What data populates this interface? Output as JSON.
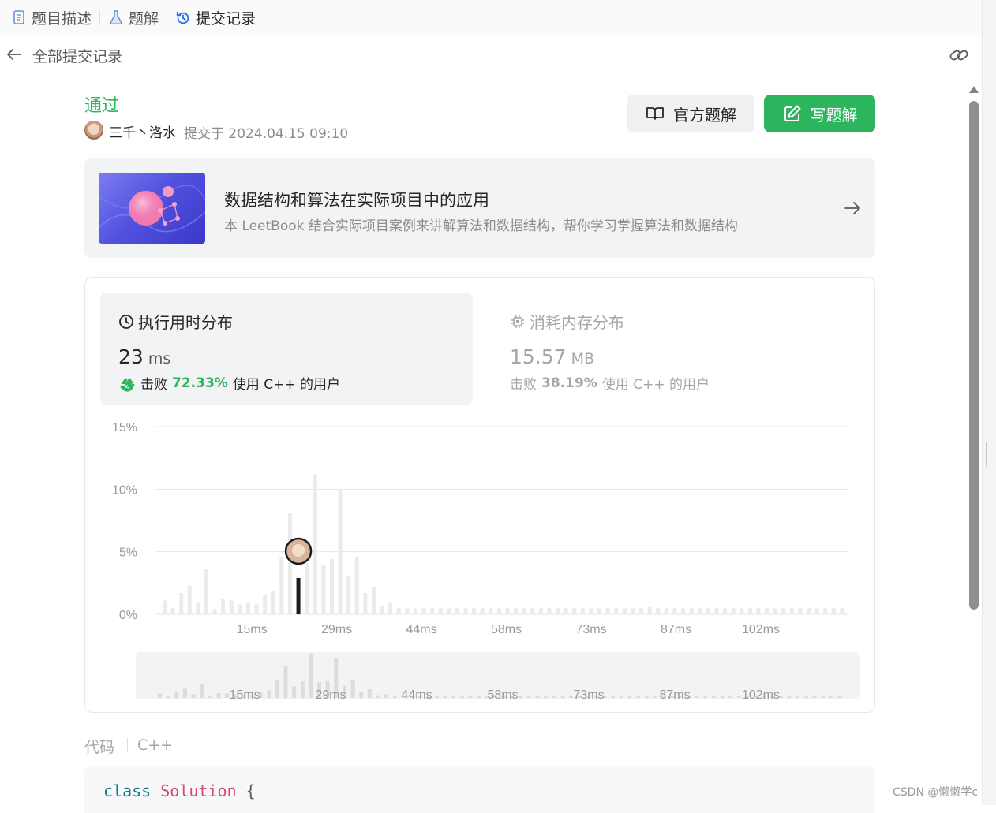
{
  "tabs": [
    {
      "label": "题目描述",
      "icon": "document-icon"
    },
    {
      "label": "题解",
      "icon": "flask-icon"
    },
    {
      "label": "提交记录",
      "icon": "history-icon"
    }
  ],
  "subheader": {
    "title": "全部提交记录"
  },
  "submission": {
    "status": "通过",
    "author": "三千丶洛水",
    "submitted_label": "提交于 2024.04.15 09:10"
  },
  "buttons": {
    "official": "官方题解",
    "write": "写题解"
  },
  "leetbook": {
    "title": "数据结构和算法在实际项目中的应用",
    "desc": "本 LeetBook 结合实际项目案例来讲解算法和数据结构，帮你学习掌握算法和数据结构"
  },
  "runtime": {
    "title": "执行用时分布",
    "value": "23",
    "unit": "ms",
    "beats_prefix": "击败",
    "beats_pct": "72.33%",
    "beats_suffix": "使用 C++ 的用户"
  },
  "memory": {
    "title": "消耗内存分布",
    "value": "15.57",
    "unit": "MB",
    "beats_prefix": "击败",
    "beats_pct": "38.19%",
    "beats_suffix": "使用 C++ 的用户"
  },
  "chart_data": {
    "type": "bar",
    "title": "",
    "xlabel": "",
    "ylabel": "",
    "ylim": [
      0,
      15
    ],
    "yticks": [
      "0%",
      "5%",
      "10%",
      "15%"
    ],
    "xticks": [
      "15ms",
      "29ms",
      "44ms",
      "58ms",
      "73ms",
      "87ms",
      "102ms"
    ],
    "highlight_index": 16,
    "values": [
      1.1,
      0.5,
      1.7,
      2.3,
      0.9,
      3.6,
      0.4,
      1.2,
      1.1,
      0.8,
      0.9,
      0.8,
      1.5,
      1.9,
      4.6,
      8.1,
      2.9,
      4.1,
      11.2,
      3.9,
      4.4,
      10.0,
      3.1,
      4.6,
      1.7,
      2.2,
      0.7,
      0.9,
      0.5,
      0.5,
      0.5,
      0.5,
      0.5,
      0.5,
      0.5,
      0.5,
      0.5,
      0.5,
      0.5,
      0.5,
      0.5,
      0.5,
      0.5,
      0.5,
      0.5,
      0.5,
      0.5,
      0.5,
      0.5,
      0.5,
      0.5,
      0.5,
      0.5,
      0.5,
      0.5,
      0.5,
      0.5,
      0.5,
      0.6,
      0.5,
      0.5,
      0.5,
      0.5,
      0.5,
      0.5,
      0.5,
      0.5,
      0.5,
      0.5,
      0.5,
      0.5,
      0.5,
      0.5,
      0.5,
      0.5,
      0.5,
      0.5,
      0.5,
      0.5,
      0.5,
      0.5,
      0.5
    ]
  },
  "code": {
    "label": "代码",
    "lang": "C++",
    "kw": "class",
    "cls": "Solution",
    "brace": "{"
  },
  "watermark": "CSDN @懒懒学c",
  "colors": {
    "accent": "#2db55d",
    "bar": "#ebebeb",
    "highlight": "#1a1a1a",
    "tab_active": "#1a73e8"
  }
}
